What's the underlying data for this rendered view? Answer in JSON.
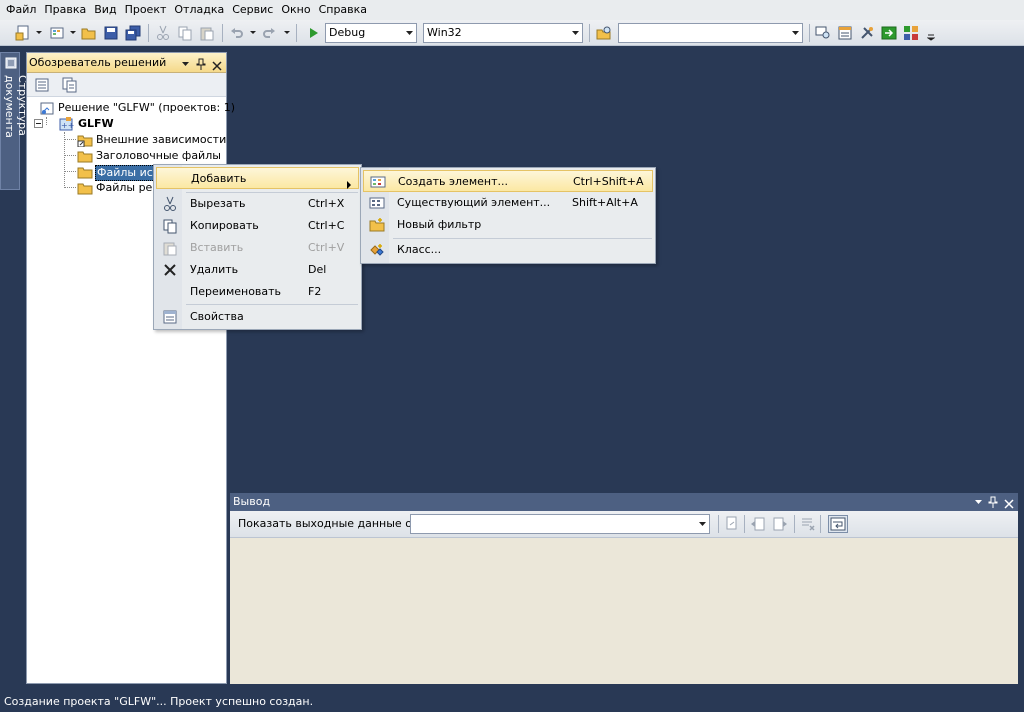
{
  "menubar": {
    "items": [
      "Файл",
      "Правка",
      "Вид",
      "Проект",
      "Отладка",
      "Сервис",
      "Окно",
      "Справка"
    ]
  },
  "toolbar": {
    "config_combo": "Debug",
    "platform_combo": "Win32",
    "find_combo": ""
  },
  "left_tab": {
    "label": "Структура документа"
  },
  "solution_explorer": {
    "title": "Обозреватель решений",
    "solution_label": "Решение \"GLFW\" (проектов: 1)",
    "project_label": "GLFW",
    "folders": [
      "Внешние зависимости",
      "Заголовочные файлы",
      "Файлы исходного кода",
      "Файлы ресурсов"
    ]
  },
  "context_menu": {
    "items": [
      {
        "label": "Добавить",
        "shortcut": "",
        "icon": "add-icon",
        "has_submenu": true,
        "highlighted": true,
        "disabled": false
      },
      {
        "label": "Вырезать",
        "shortcut": "Ctrl+X",
        "icon": "scissors-icon",
        "disabled": false
      },
      {
        "label": "Копировать",
        "shortcut": "Ctrl+C",
        "icon": "copy-icon",
        "disabled": false
      },
      {
        "label": "Вставить",
        "shortcut": "Ctrl+V",
        "icon": "paste-icon",
        "disabled": true
      },
      {
        "label": "Удалить",
        "shortcut": "Del",
        "icon": "delete-icon",
        "disabled": false
      },
      {
        "label": "Переименовать",
        "shortcut": "F2",
        "icon": "",
        "disabled": false
      },
      {
        "label": "Свойства",
        "shortcut": "",
        "icon": "properties-icon",
        "disabled": false
      }
    ]
  },
  "submenu": {
    "items": [
      {
        "label": "Создать элемент...",
        "shortcut": "Ctrl+Shift+A",
        "icon": "new-item-icon",
        "highlighted": true
      },
      {
        "label": "Существующий элемент...",
        "shortcut": "Shift+Alt+A",
        "icon": "existing-item-icon"
      },
      {
        "label": "Новый фильтр",
        "shortcut": "",
        "icon": "new-filter-folder-icon"
      },
      {
        "label": "Класс...",
        "shortcut": "",
        "icon": "class-icon"
      }
    ]
  },
  "output": {
    "title": "Вывод",
    "show_from_label": "Показать выходные данные от:",
    "source_value": ""
  },
  "statusbar": {
    "text": "Создание проекта \"GLFW\"... Проект успешно создан."
  },
  "colors": {
    "ide_background": "#293955",
    "menu_background": "#e9ecee",
    "highlight": "#fbe8a3",
    "panel_title": "#4d6082",
    "output_background": "#ebe7d9"
  }
}
